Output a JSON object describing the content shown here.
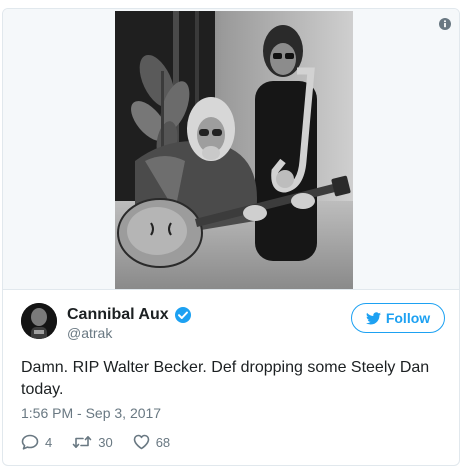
{
  "tweet": {
    "user": {
      "name": "Cannibal Aux",
      "handle": "@atrak",
      "verified": true
    },
    "follow_label": "Follow",
    "text": "Damn. RIP Walter Becker. Def dropping some Steely Dan today.",
    "timestamp": "1:56 PM - Sep 3, 2017",
    "actions": {
      "reply_count": "4",
      "retweet_count": "30",
      "like_count": "68"
    }
  },
  "icons": {
    "info": "info-circle-icon",
    "verified": "verified-badge-icon",
    "follow": "twitter-bird-icon",
    "reply": "reply-icon",
    "retweet": "retweet-icon",
    "like": "heart-icon"
  },
  "colors": {
    "accent": "#1da1f2",
    "text": "#1c2022",
    "secondary_text": "#697882",
    "border": "#e1e8ed",
    "media_background": "#f5f8fa"
  }
}
